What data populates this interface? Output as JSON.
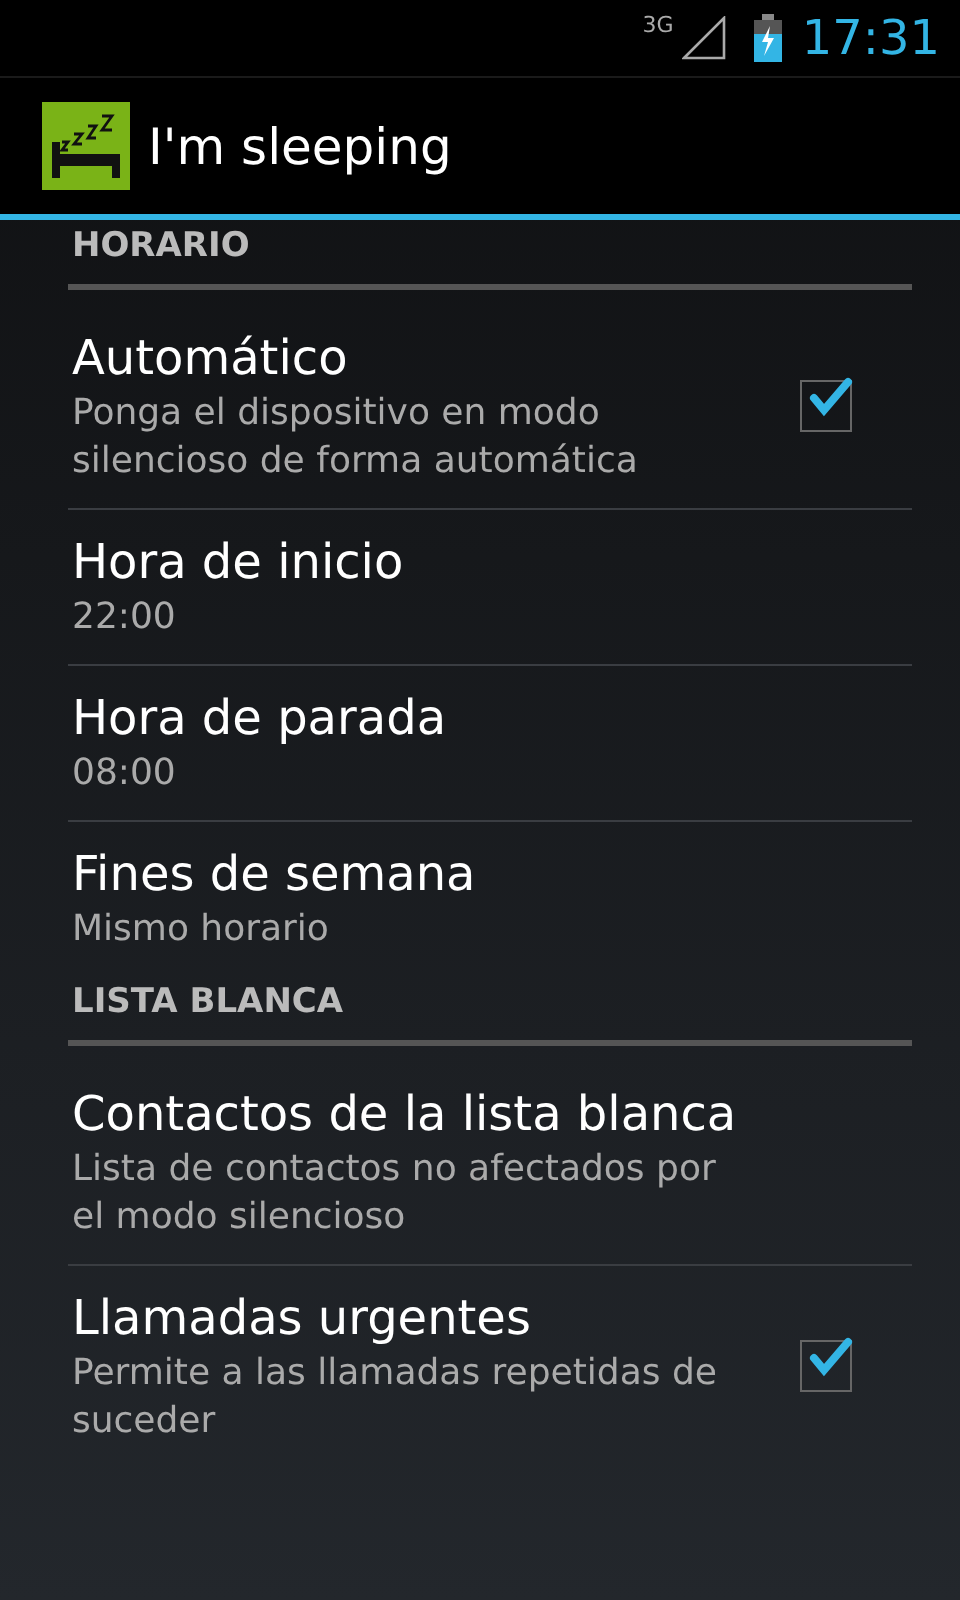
{
  "status_bar": {
    "network": "3G",
    "time": "17:31"
  },
  "action_bar": {
    "title": "I'm sleeping"
  },
  "sections": [
    {
      "header": "HORARIO",
      "items": [
        {
          "kind": "checkbox",
          "title": "Automático",
          "summary": "Ponga el dispositivo en modo silencioso de forma automática",
          "checked": true
        },
        {
          "kind": "plain",
          "title": "Hora de inicio",
          "summary": "22:00"
        },
        {
          "kind": "plain",
          "title": "Hora de parada",
          "summary": "08:00"
        },
        {
          "kind": "plain",
          "title": "Fines de semana",
          "summary": "Mismo horario"
        }
      ]
    },
    {
      "header": "LISTA BLANCA",
      "items": [
        {
          "kind": "plain",
          "title": "Contactos de la lista blanca",
          "summary": "Lista de contactos no afectados por el modo silencioso"
        },
        {
          "kind": "checkbox",
          "title": "Llamadas urgentes",
          "summary": "Permite a las llamadas repetidas de suceder",
          "checked": true
        }
      ]
    }
  ]
}
